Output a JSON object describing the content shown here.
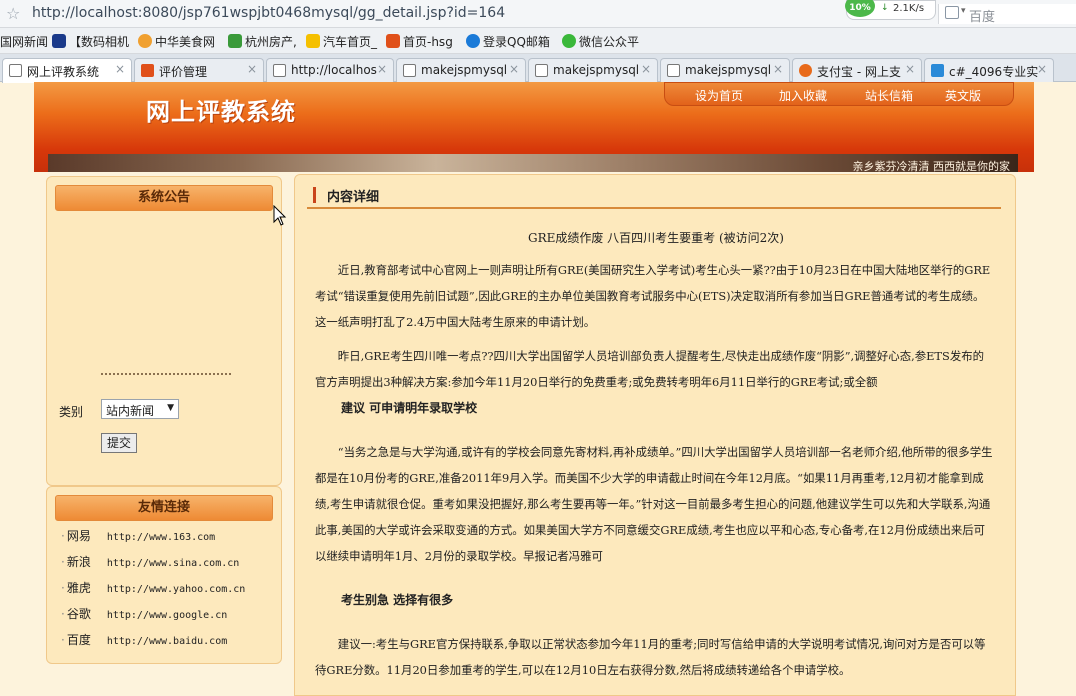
{
  "browser": {
    "url": "http://localhost:8080/jsp761wspjbt0468mysql/gg_detail.jsp?id=164",
    "speed_badge": "10%",
    "speed_rate": "2.1K/s",
    "search_engine": "百度",
    "bookmarks": [
      "国网新闻",
      "【数码相机",
      "中华美食网",
      "杭州房产,",
      "汽车首页_",
      "首页-hsg",
      "登录QQ邮箱",
      "微信公众平"
    ],
    "tabs": [
      "网上评教系统",
      "评价管理",
      "http://localhos",
      "makejspmysql",
      "makejspmysql",
      "makejspmysql",
      "支付宝 - 网上支",
      "c#_4096专业实"
    ]
  },
  "site": {
    "title": "网上评教系统",
    "nav": [
      "设为首页",
      "加入收藏",
      "站长信箱",
      "英文版"
    ],
    "slogan": "亲乡紫芬冷清清 西西就是你的家"
  },
  "sidebar": {
    "notice_title": "系统公告",
    "category_label": "类别",
    "category_value": "站内新闻",
    "submit_label": "提交",
    "links_title": "友情连接",
    "links": [
      {
        "name": "网易",
        "url": "http://www.163.com"
      },
      {
        "name": "新浪",
        "url": "http://www.sina.com.cn"
      },
      {
        "name": "雅虎",
        "url": "http://www.yahoo.com.cn"
      },
      {
        "name": "谷歌",
        "url": "http://www.google.cn"
      },
      {
        "name": "百度",
        "url": "http://www.baidu.com"
      }
    ]
  },
  "content": {
    "section_label": "内容详细",
    "title": "GRE成绩作废 八百四川考生要重考 (被访问2次)",
    "para1": "近日,教育部考试中心官网上一则声明让所有GRE(美国研究生入学考试)考生心头一紧??由于10月23日在中国大陆地区举行的GRE考试“错误重复使用先前旧试题”,因此GRE的主办单位美国教育考试服务中心(ETS)决定取消所有参加当日GRE普通考试的考生成绩。这一纸声明打乱了2.4万中国大陆考生原来的申请计划。",
    "para2": "昨日,GRE考生四川唯一考点??四川大学出国留学人员培训部负责人提醒考生,尽快走出成绩作废“阴影”,调整好心态,参ETS发布的官方声明提出3种解决方案:参加今年11月20日举行的免费重考;或免费转考明年6月11日举行的GRE考试;或全额",
    "heading1": "建议 可申请明年录取学校",
    "para3": "“当务之急是与大学沟通,或许有的学校会同意先寄材料,再补成绩单。”四川大学出国留学人员培训部一名老师介绍,他所带的很多学生都是在10月份考的GRE,准备2011年9月入学。而美国不少大学的申请截止时间在今年12月底。“如果11月再重考,12月初才能拿到成绩,考生申请就很仓促。重考如果没把握好,那么考生要再等一年。”针对这一目前最多考生担心的问题,他建议学生可以先和大学联系,沟通此事,美国的大学或许会采取变通的方式。如果美国大学方不同意缓交GRE成绩,考生也应以平和心态,专心备考,在12月份成绩出来后可以继续申请明年1月、2月份的录取学校。早报记者冯雅可",
    "heading2": "考生别急 选择有很多",
    "para4": "建议一:考生与GRE官方保持联系,争取以正常状态参加今年11月的重考;同时写信给申请的大学说明考试情况,询问对方是否可以等待GRE分数。11月20日参加重考的学生,可以在12月10日左右获得分数,然后将成绩转递给各个申请学校。"
  },
  "colors": {
    "header_orange": "#ec6d1a",
    "header_red": "#c7300a",
    "page_bg": "#fdf3dc",
    "panel_bg": "#fde9bd"
  }
}
